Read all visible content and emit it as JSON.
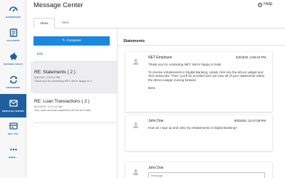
{
  "app": {
    "title": "Message Center",
    "help_label": "Help"
  },
  "nav": {
    "items": [
      {
        "label": "DASHBOARD",
        "icon": "dashboard-icon",
        "active": false
      },
      {
        "label": "ACCOUNTS",
        "icon": "accounts-icon",
        "active": false
      },
      {
        "label": "SAVINGS GOALS",
        "icon": "piggy-bank-icon",
        "active": false
      },
      {
        "label": "TRANSFERS",
        "icon": "transfer-icon",
        "active": false
      },
      {
        "label": "MESSAGE CENTER",
        "icon": "envelope-icon",
        "active": true
      },
      {
        "label": "BILL PAY",
        "icon": "bill-pay-icon",
        "active": false
      },
      {
        "label": "MORE...",
        "icon": "more-icon",
        "active": false
      }
    ]
  },
  "tabs": {
    "inbox": "Inbox",
    "sent": "Sent"
  },
  "compose": {
    "label": "Compose"
  },
  "edit_label": "Edit",
  "conversations": [
    {
      "title": "RE: Statements ( 2 )",
      "date": "8/3/2020, 2:50:22 PM",
      "preview": "Thank you for contacting NET, We're happy to h...",
      "selected": true
    },
    {
      "title": "RE: Loan Transactions ( 2 )",
      "date": "6/11/2020, 11:11:41 AM",
      "preview": "Your open and loan payments will not be treate...",
      "selected": false
    }
  ],
  "thread": {
    "title": "Statements",
    "messages": [
      {
        "sender": "NET Employee",
        "time": "8/3/2020, 2:50:22 PM",
        "paragraphs": [
          "Thank you for contacting NET, We're happy to help!",
          "To receive eStatements in Digital Banking, simply click into the eDocs widget and click Subscribe. Then, you'll be enrolled and can view all of your statements within the eDocs widget moving forward.",
          "Best,"
        ]
      },
      {
        "sender": "John Doe",
        "time": "8/3/2020, 12:47:08 PM",
        "paragraphs": [
          "How do I sign up and view my eStatements in Digital Banking?"
        ]
      }
    ],
    "reply": {
      "sender": "John Doe",
      "placeholder": "Message..."
    }
  },
  "colors": {
    "brand": "#1f5f9e",
    "compose": "#1a88df",
    "selected_row": "#ededef"
  }
}
